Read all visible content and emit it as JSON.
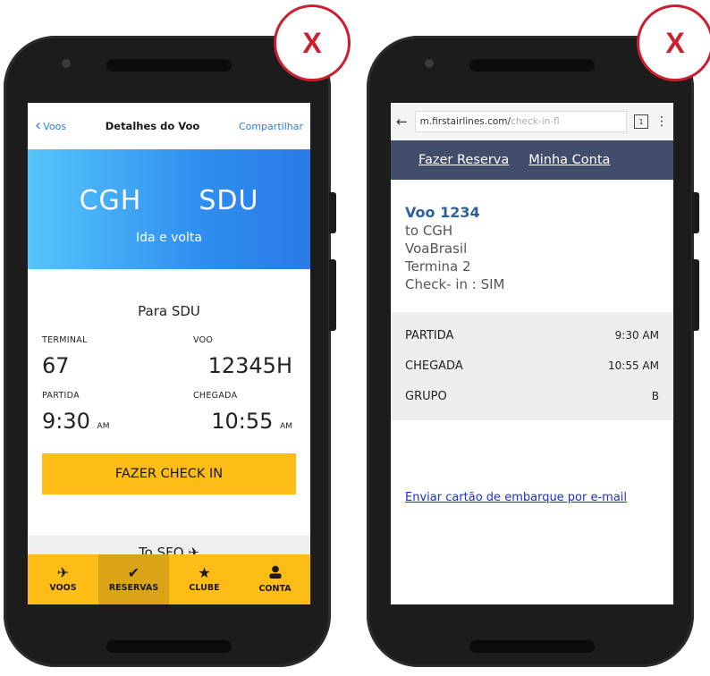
{
  "mark_label": "X",
  "left": {
    "nav": {
      "back_label": "Voos",
      "title": "Detalhes do Voo",
      "share_label": "Compartilhar"
    },
    "hero": {
      "origin": "CGH",
      "destination": "SDU",
      "trip_type": "Ida e volta"
    },
    "leg": {
      "heading": "Para SDU",
      "terminal_label": "TERMINAL",
      "terminal": "67",
      "flight_label": "VOO",
      "flight": "12345H",
      "departure_label": "PARTIDA",
      "departure_time": "9:30",
      "departure_ampm": "AM",
      "arrival_label": "CHEGADA",
      "arrival_time": "10:55",
      "arrival_ampm": "AM"
    },
    "checkin_label": "FAZER CHECK IN",
    "next_leg": "To SFO",
    "tabs": [
      {
        "label": "VOOS",
        "icon": "plane-icon"
      },
      {
        "label": "RESERVAS",
        "icon": "checkmark-icon"
      },
      {
        "label": "CLUBE",
        "icon": "star-icon"
      },
      {
        "label": "CONTA",
        "icon": "person-icon"
      }
    ]
  },
  "right": {
    "browser": {
      "url_main": "m.firstairlines.com/",
      "url_faded": "check-in-fl",
      "tab_count": "1"
    },
    "menu": {
      "reserve": "Fazer Reserva",
      "account": "Minha Conta"
    },
    "flight": {
      "number": "Voo 1234",
      "to": "to CGH",
      "airline": "VoaBrasil",
      "terminal": "Termina 2",
      "checkin": "Check- in : SIM"
    },
    "rows": [
      {
        "label": "PARTIDA",
        "value": "9:30 AM"
      },
      {
        "label": "CHEGADA",
        "value": "10:55 AM"
      },
      {
        "label": "GRUPO",
        "value": "B"
      }
    ],
    "mail_link": "Enviar cartão de embarque por e-mail"
  },
  "colors": {
    "accent_yellow": "#fdbc16",
    "mark_red": "#cc1f2e",
    "menu_navy": "#414d6b",
    "link_blue": "#2b7be4"
  }
}
